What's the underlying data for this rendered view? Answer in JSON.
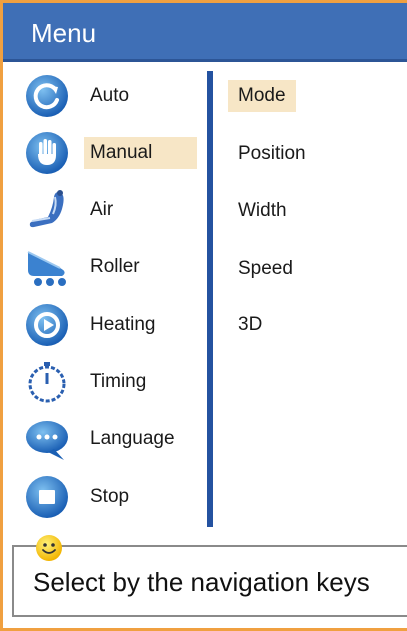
{
  "header": {
    "title": "Menu"
  },
  "left_menu": {
    "selected_index": 1,
    "items": [
      {
        "label": "Auto",
        "icon": "auto-icon"
      },
      {
        "label": "Manual",
        "icon": "hand-icon"
      },
      {
        "label": "Air",
        "icon": "air-massage-chair-icon"
      },
      {
        "label": "Roller",
        "icon": "roller-icon"
      },
      {
        "label": "Heating",
        "icon": "heating-icon"
      },
      {
        "label": "Timing",
        "icon": "timer-icon"
      },
      {
        "label": "Language",
        "icon": "speech-bubble-icon"
      },
      {
        "label": "Stop",
        "icon": "stop-icon"
      }
    ]
  },
  "right_menu": {
    "selected_index": 0,
    "items": [
      {
        "label": "Mode"
      },
      {
        "label": "Position"
      },
      {
        "label": "Width"
      },
      {
        "label": "Speed"
      },
      {
        "label": "3D"
      }
    ]
  },
  "hint": {
    "text": "Select by the navigation keys",
    "icon": "smiley-icon"
  },
  "colors": {
    "header_bg": "#3f6fb6",
    "selection_bg": "#f7e6c6",
    "frame_border": "#f0a040",
    "divider": "#2452a0"
  }
}
